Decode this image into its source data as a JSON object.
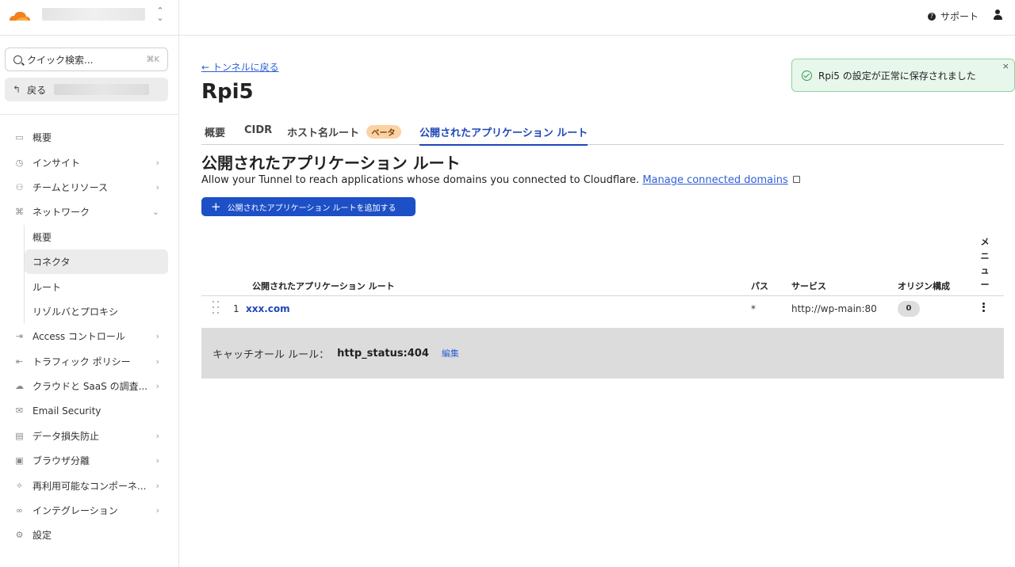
{
  "sidebar": {
    "search_placeholder": "クイック検索...",
    "search_shortcut": "⌘K",
    "back_label": "戻る",
    "items": [
      {
        "label": "概要",
        "icon": "window-icon"
      },
      {
        "label": "インサイト",
        "icon": "clock-icon"
      },
      {
        "label": "チームとリソース",
        "icon": "people-icon"
      },
      {
        "label": "ネットワーク",
        "icon": "network-icon"
      },
      {
        "label": "Access コントロール",
        "icon": "login-icon"
      },
      {
        "label": "トラフィック ポリシー",
        "icon": "traffic-icon"
      },
      {
        "label": "クラウドと SaaS の調査...",
        "icon": "cloud-icon"
      },
      {
        "label": "Email Security",
        "icon": "email-icon"
      },
      {
        "label": "データ損失防止",
        "icon": "document-icon"
      },
      {
        "label": "ブラウザ分離",
        "icon": "browser-icon"
      },
      {
        "label": "再利用可能なコンポーネ...",
        "icon": "puzzle-icon"
      },
      {
        "label": "インテグレーション",
        "icon": "link-icon"
      },
      {
        "label": "設定",
        "icon": "gear-icon"
      }
    ],
    "network_sub": [
      "概要",
      "コネクタ",
      "ルート",
      "リゾルバとプロキシ"
    ]
  },
  "topbar": {
    "support_label": "サポート"
  },
  "page": {
    "back_link": "← トンネルに戻る",
    "title": "Rpi5",
    "tabs": [
      "概要",
      "CIDR",
      "ホスト名ルート",
      "公開されたアプリケーション ルート"
    ],
    "beta_badge": "ベータ",
    "section_title": "公開されたアプリケーション ルート",
    "section_desc": "Allow your Tunnel to reach applications whose domains you connected to Cloudflare.",
    "section_link": "Manage connected domains",
    "add_button": "公開されたアプリケーション ルートを追加する"
  },
  "table": {
    "headers": {
      "route": "公開されたアプリケーション ルート",
      "path": "パス",
      "service": "サービス",
      "origin": "オリジン構成",
      "menu": [
        "メ",
        "ニ",
        "ュ",
        "ー"
      ]
    },
    "rows": [
      {
        "num": "1",
        "host": "xxx.com",
        "path": "*",
        "service": "http://wp-main:80",
        "origin": "0"
      }
    ],
    "catchall_label": "キャッチオール ルール：",
    "catchall_value": "http_status:404",
    "catchall_edit": "編集"
  },
  "toast": {
    "message": "Rpi5 の設定が正常に保存されました",
    "close": "×"
  },
  "colors": {
    "accent": "#1d4fc7",
    "link": "#2f5fd6",
    "toast_bg": "#e8f7ec",
    "toast_border": "#8fd3a1",
    "beta_bg": "#fbd2a6",
    "logo": "#f38020"
  }
}
